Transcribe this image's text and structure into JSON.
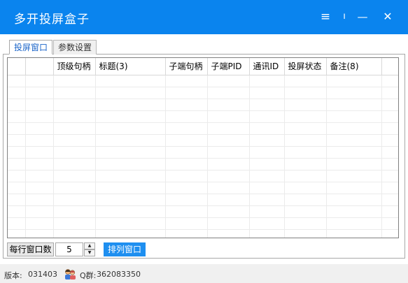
{
  "window": {
    "title": "多开投屏盒子"
  },
  "titlebar": {
    "menu_icon": "≡",
    "separator_icon": "ı",
    "minimize_icon": "—",
    "close_icon": "✕"
  },
  "tabs": [
    {
      "label": "投屏窗口",
      "active": true
    },
    {
      "label": "参数设置",
      "active": false
    }
  ],
  "table": {
    "columns": [
      "",
      "",
      "顶级句柄",
      "标题(3)",
      "子端句柄",
      "子端PID",
      "通讯ID",
      "投屏状态",
      "备注(8)",
      ""
    ],
    "rows": []
  },
  "controls": {
    "per_row_label": "每行窗口数",
    "per_row_value": "5",
    "spin_up": "▲",
    "spin_down": "▼",
    "arrange_button": "排列窗口"
  },
  "status": {
    "version_label": "版本:",
    "version_value": "031403",
    "qq_label": "Q群:",
    "qq_value": "362083350"
  },
  "colors": {
    "titlebar": "#0a84ee",
    "button": "#1e8ff0",
    "active_tab_text": "#1a64c8"
  }
}
